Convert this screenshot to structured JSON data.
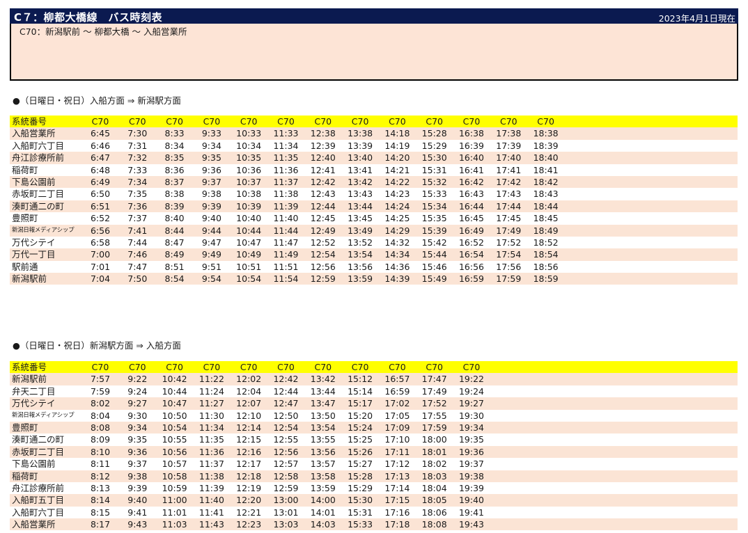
{
  "header": {
    "title": "C７：柳都大橋線　バス時刻表",
    "as_of": "2023年4月1日現在",
    "route": "C70：新潟駅前 ～ 柳都大橋 ～ 入船営業所"
  },
  "tables": [
    {
      "title": "●（日曜日・祝日）入船方面 ⇒ 新潟駅方面",
      "route_label": "系統番号",
      "routes": [
        "C70",
        "C70",
        "C70",
        "C70",
        "C70",
        "C70",
        "C70",
        "C70",
        "C70",
        "C70",
        "C70",
        "C70",
        "C70"
      ],
      "rows": [
        {
          "stop": "入船営業所",
          "times": [
            "6:45",
            "7:30",
            "8:33",
            "9:33",
            "10:33",
            "11:33",
            "12:38",
            "13:38",
            "14:18",
            "15:28",
            "16:38",
            "17:38",
            "18:38"
          ]
        },
        {
          "stop": "入船町六丁目",
          "times": [
            "6:46",
            "7:31",
            "8:34",
            "9:34",
            "10:34",
            "11:34",
            "12:39",
            "13:39",
            "14:19",
            "15:29",
            "16:39",
            "17:39",
            "18:39"
          ]
        },
        {
          "stop": "舟江診療所前",
          "times": [
            "6:47",
            "7:32",
            "8:35",
            "9:35",
            "10:35",
            "11:35",
            "12:40",
            "13:40",
            "14:20",
            "15:30",
            "16:40",
            "17:40",
            "18:40"
          ]
        },
        {
          "stop": "稲荷町",
          "times": [
            "6:48",
            "7:33",
            "8:36",
            "9:36",
            "10:36",
            "11:36",
            "12:41",
            "13:41",
            "14:21",
            "15:31",
            "16:41",
            "17:41",
            "18:41"
          ]
        },
        {
          "stop": "下島公園前",
          "times": [
            "6:49",
            "7:34",
            "8:37",
            "9:37",
            "10:37",
            "11:37",
            "12:42",
            "13:42",
            "14:22",
            "15:32",
            "16:42",
            "17:42",
            "18:42"
          ]
        },
        {
          "stop": "赤坂町二丁目",
          "times": [
            "6:50",
            "7:35",
            "8:38",
            "9:38",
            "10:38",
            "11:38",
            "12:43",
            "13:43",
            "14:23",
            "15:33",
            "16:43",
            "17:43",
            "18:43"
          ]
        },
        {
          "stop": "湊町通二の町",
          "times": [
            "6:51",
            "7:36",
            "8:39",
            "9:39",
            "10:39",
            "11:39",
            "12:44",
            "13:44",
            "14:24",
            "15:34",
            "16:44",
            "17:44",
            "18:44"
          ]
        },
        {
          "stop": "豊照町",
          "times": [
            "6:52",
            "7:37",
            "8:40",
            "9:40",
            "10:40",
            "11:40",
            "12:45",
            "13:45",
            "14:25",
            "15:35",
            "16:45",
            "17:45",
            "18:45"
          ]
        },
        {
          "stop": "新潟日報メディアシップ",
          "small": true,
          "times": [
            "6:56",
            "7:41",
            "8:44",
            "9:44",
            "10:44",
            "11:44",
            "12:49",
            "13:49",
            "14:29",
            "15:39",
            "16:49",
            "17:49",
            "18:49"
          ]
        },
        {
          "stop": "万代シテイ",
          "times": [
            "6:58",
            "7:44",
            "8:47",
            "9:47",
            "10:47",
            "11:47",
            "12:52",
            "13:52",
            "14:32",
            "15:42",
            "16:52",
            "17:52",
            "18:52"
          ]
        },
        {
          "stop": "万代一丁目",
          "times": [
            "7:00",
            "7:46",
            "8:49",
            "9:49",
            "10:49",
            "11:49",
            "12:54",
            "13:54",
            "14:34",
            "15:44",
            "16:54",
            "17:54",
            "18:54"
          ]
        },
        {
          "stop": "駅前通",
          "times": [
            "7:01",
            "7:47",
            "8:51",
            "9:51",
            "10:51",
            "11:51",
            "12:56",
            "13:56",
            "14:36",
            "15:46",
            "16:56",
            "17:56",
            "18:56"
          ]
        },
        {
          "stop": "新潟駅前",
          "times": [
            "7:04",
            "7:50",
            "8:54",
            "9:54",
            "10:54",
            "11:54",
            "12:59",
            "13:59",
            "14:39",
            "15:49",
            "16:59",
            "17:59",
            "18:59"
          ]
        }
      ]
    },
    {
      "title": "●（日曜日・祝日）新潟駅方面 ⇒ 入船方面",
      "route_label": "系統番号",
      "routes": [
        "C70",
        "C70",
        "C70",
        "C70",
        "C70",
        "C70",
        "C70",
        "C70",
        "C70",
        "C70",
        "C70"
      ],
      "rows": [
        {
          "stop": "新潟駅前",
          "times": [
            "7:57",
            "9:22",
            "10:42",
            "11:22",
            "12:02",
            "12:42",
            "13:42",
            "15:12",
            "16:57",
            "17:47",
            "19:22"
          ]
        },
        {
          "stop": "弁天二丁目",
          "times": [
            "7:59",
            "9:24",
            "10:44",
            "11:24",
            "12:04",
            "12:44",
            "13:44",
            "15:14",
            "16:59",
            "17:49",
            "19:24"
          ]
        },
        {
          "stop": "万代シテイ",
          "times": [
            "8:02",
            "9:27",
            "10:47",
            "11:27",
            "12:07",
            "12:47",
            "13:47",
            "15:17",
            "17:02",
            "17:52",
            "19:27"
          ]
        },
        {
          "stop": "新潟日報メディアシップ",
          "small": true,
          "times": [
            "8:04",
            "9:30",
            "10:50",
            "11:30",
            "12:10",
            "12:50",
            "13:50",
            "15:20",
            "17:05",
            "17:55",
            "19:30"
          ]
        },
        {
          "stop": "豊照町",
          "times": [
            "8:08",
            "9:34",
            "10:54",
            "11:34",
            "12:14",
            "12:54",
            "13:54",
            "15:24",
            "17:09",
            "17:59",
            "19:34"
          ]
        },
        {
          "stop": "湊町通二の町",
          "times": [
            "8:09",
            "9:35",
            "10:55",
            "11:35",
            "12:15",
            "12:55",
            "13:55",
            "15:25",
            "17:10",
            "18:00",
            "19:35"
          ]
        },
        {
          "stop": "赤坂町二丁目",
          "times": [
            "8:10",
            "9:36",
            "10:56",
            "11:36",
            "12:16",
            "12:56",
            "13:56",
            "15:26",
            "17:11",
            "18:01",
            "19:36"
          ]
        },
        {
          "stop": "下島公園前",
          "times": [
            "8:11",
            "9:37",
            "10:57",
            "11:37",
            "12:17",
            "12:57",
            "13:57",
            "15:27",
            "17:12",
            "18:02",
            "19:37"
          ]
        },
        {
          "stop": "稲荷町",
          "times": [
            "8:12",
            "9:38",
            "10:58",
            "11:38",
            "12:18",
            "12:58",
            "13:58",
            "15:28",
            "17:13",
            "18:03",
            "19:38"
          ]
        },
        {
          "stop": "舟江診療所前",
          "times": [
            "8:13",
            "9:39",
            "10:59",
            "11:39",
            "12:19",
            "12:59",
            "13:59",
            "15:29",
            "17:14",
            "18:04",
            "19:39"
          ]
        },
        {
          "stop": "入船町五丁目",
          "times": [
            "8:14",
            "9:40",
            "11:00",
            "11:40",
            "12:20",
            "13:00",
            "14:00",
            "15:30",
            "17:15",
            "18:05",
            "19:40"
          ]
        },
        {
          "stop": "入船町六丁目",
          "times": [
            "8:15",
            "9:41",
            "11:01",
            "11:41",
            "12:21",
            "13:01",
            "14:01",
            "15:31",
            "17:16",
            "18:06",
            "19:41"
          ]
        },
        {
          "stop": "入船営業所",
          "times": [
            "8:17",
            "9:43",
            "11:03",
            "11:43",
            "12:23",
            "13:03",
            "14:03",
            "15:33",
            "17:18",
            "18:08",
            "19:43"
          ]
        }
      ]
    }
  ]
}
